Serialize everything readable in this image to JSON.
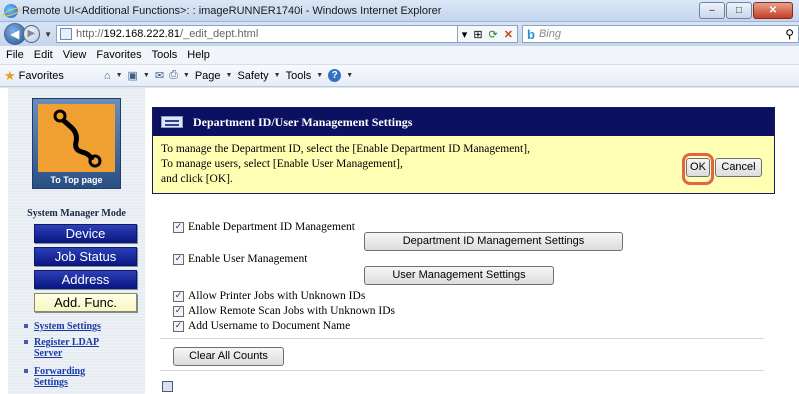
{
  "window": {
    "title": "Remote UI<Additional Functions>: : imageRUNNER1740i - Windows Internet Explorer",
    "controls": [
      "–",
      "□",
      "✕"
    ]
  },
  "address": {
    "url_prefix": "http://",
    "url_host": "192.168.222.81",
    "url_path": "/_edit_dept.html",
    "search_placeholder": "Bing"
  },
  "menu": [
    "File",
    "Edit",
    "View",
    "Favorites",
    "Tools",
    "Help"
  ],
  "favbar": {
    "favorites_label": "Favorites",
    "tools": [
      "Page",
      "Safety",
      "Tools"
    ]
  },
  "sidebar": {
    "top_page_label": "To Top page",
    "mode_title": "System Manager Mode",
    "buttons": [
      "Device",
      "Job Status",
      "Address",
      "Add. Func."
    ],
    "links": [
      "System Settings",
      "Register LDAP Server",
      "Forwarding Settings"
    ]
  },
  "header": {
    "title": "Department ID/User Management Settings",
    "line1": "To manage the Department ID, select the [Enable Department ID Management],",
    "line2": "To manage users, select [Enable User Management],",
    "line3": "and click [OK].",
    "ok_label": "OK",
    "cancel_label": "Cancel"
  },
  "options": {
    "enable_dept": "Enable Department ID Management",
    "dept_settings_btn": "Department ID Management Settings",
    "enable_user": "Enable User Management",
    "user_settings_btn": "User Management Settings",
    "allow_printer": "Allow Printer Jobs with Unknown IDs",
    "allow_scan": "Allow Remote Scan Jobs with Unknown IDs",
    "add_username": "Add Username to Document Name",
    "clear_counts_btn": "Clear All Counts"
  },
  "colors": {
    "header_bg": "#0c1060",
    "message_bg": "#ffffb3",
    "nav_button": "#0a1883",
    "highlight_ring": "#e2624a"
  }
}
